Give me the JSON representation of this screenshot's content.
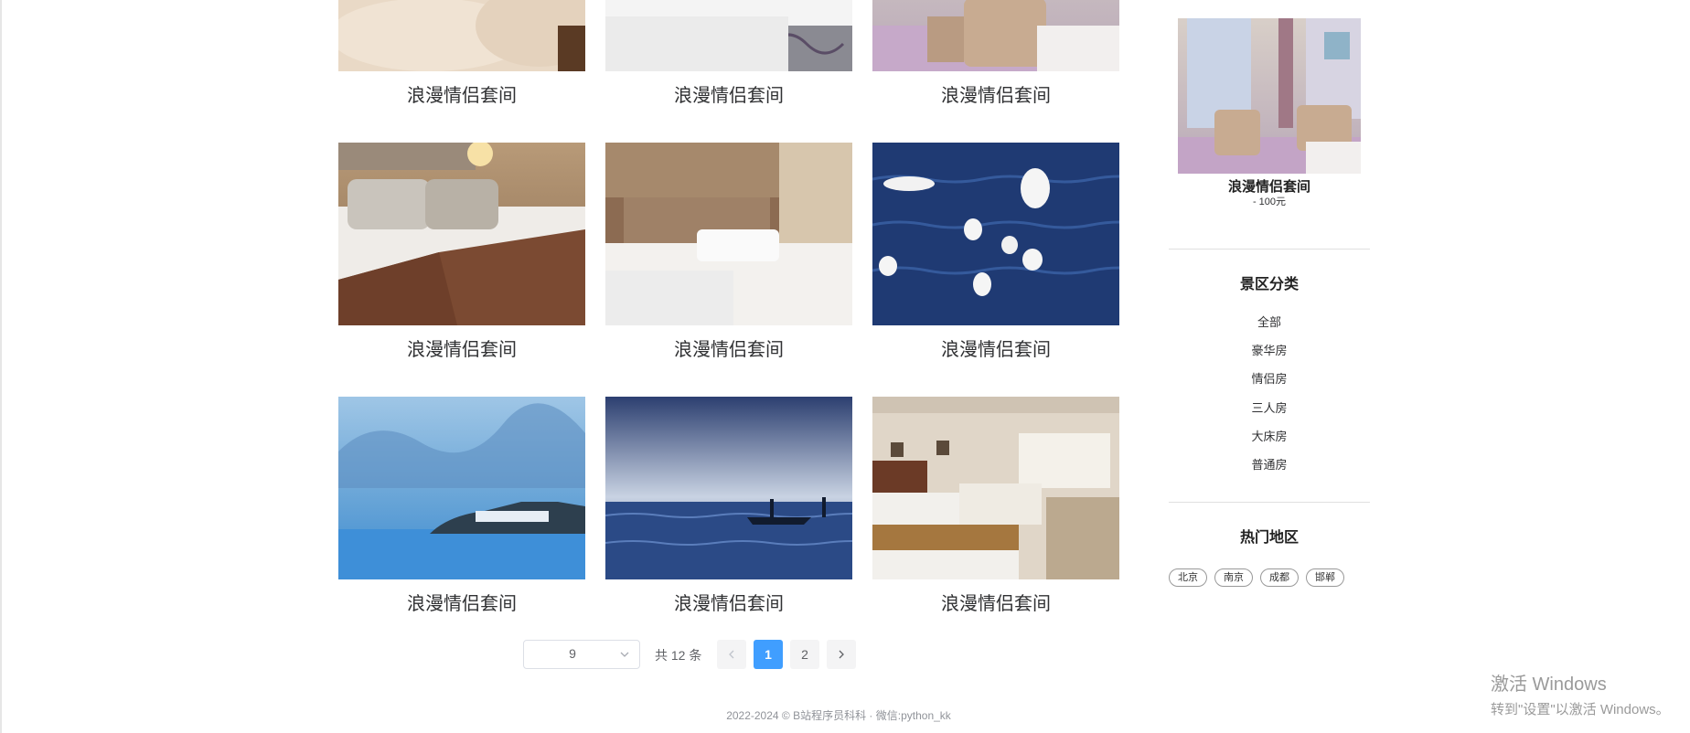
{
  "rooms": [
    {
      "title": "浪漫情侣套间",
      "image": "bed-closeup"
    },
    {
      "title": "浪漫情侣套间",
      "image": "white-bed"
    },
    {
      "title": "浪漫情侣套间",
      "image": "room-armchairs"
    },
    {
      "title": "浪漫情侣套间",
      "image": "bed-brown-throw"
    },
    {
      "title": "浪漫情侣套间",
      "image": "twin-beds"
    },
    {
      "title": "浪漫情侣套间",
      "image": "seagulls-lake"
    },
    {
      "title": "浪漫情侣套间",
      "image": "lake-town"
    },
    {
      "title": "浪漫情侣套间",
      "image": "boat-lake"
    },
    {
      "title": "浪漫情侣套间",
      "image": "hotel-twin-room"
    }
  ],
  "pagination": {
    "page_size": "9",
    "total": "共 12 条",
    "prev_icon": "chevron-left-icon",
    "next_icon": "chevron-right-icon",
    "pages": [
      "1",
      "2"
    ],
    "current_page": "1"
  },
  "sidebar": {
    "featured": {
      "name": "浪漫情侣套间",
      "price": "- 100元"
    },
    "categories_title": "景区分类",
    "categories": [
      "全部",
      "豪华房",
      "情侣房",
      "三人房",
      "大床房",
      "普通房"
    ],
    "regions_title": "热门地区",
    "regions": [
      "北京",
      "南京",
      "成都",
      "邯郸"
    ]
  },
  "footer": {
    "text": "2022-2024 © B站程序员科科 · 微信:python_kk"
  },
  "watermark": {
    "line1": "激活 Windows",
    "line2": "转到\"设置\"以激活 Windows。"
  },
  "colors": {
    "accent": "#409eff",
    "text": "#303133",
    "muted": "#909399"
  }
}
